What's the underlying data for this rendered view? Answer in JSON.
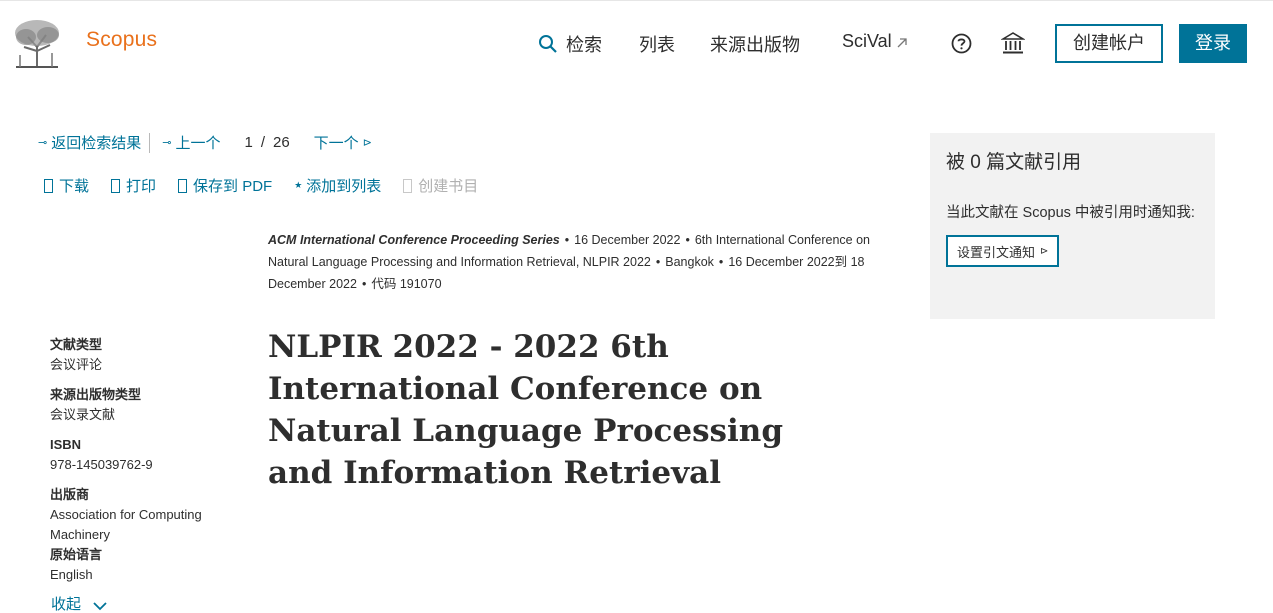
{
  "header": {
    "logo_text": "Scopus",
    "nav": {
      "search": "检索",
      "list": "列表",
      "sources": "来源出版物",
      "scival": "SciVal"
    },
    "create_account": "创建帐户",
    "login": "登录"
  },
  "pager": {
    "back": "返回检索结果",
    "prev": "上一个",
    "current": "1",
    "separator": "/",
    "total": "26",
    "next": "下一个"
  },
  "actions": {
    "download": "下载",
    "print": "打印",
    "save_pdf": "保存到 PDF",
    "add_list": "添加到列表",
    "create_bib": "创建书目"
  },
  "source": {
    "series": "ACM International Conference Proceeding Series",
    "date": "16 December 2022",
    "conference": "6th International Conference on Natural Language Processing and Information Retrieval, NLPIR 2022",
    "location": "Bangkok",
    "range": "16 December 2022到 18 December 2022",
    "code": "代码 191070"
  },
  "title": "NLPIR 2022 - 2022 6th International Conference on Natural Language Processing and Information Retrieval",
  "meta": {
    "doc_type_label": "文献类型",
    "doc_type": "会议评论",
    "source_type_label": "来源出版物类型",
    "source_type": "会议录文献",
    "isbn_label": "ISBN",
    "isbn": "978-145039762-9",
    "publisher_label": "出版商",
    "publisher": "Association for Computing Machinery",
    "language_label": "原始语言",
    "language": "English",
    "collapse": "收起"
  },
  "cited": {
    "count": "被 0 篇文献引用",
    "note": "当此文献在 Scopus 中被引用时通知我:",
    "button": "设置引文通知"
  },
  "colors": {
    "brand_orange": "#e9711c",
    "accent_blue": "#007398",
    "panel_gray": "#f2f2f2"
  }
}
